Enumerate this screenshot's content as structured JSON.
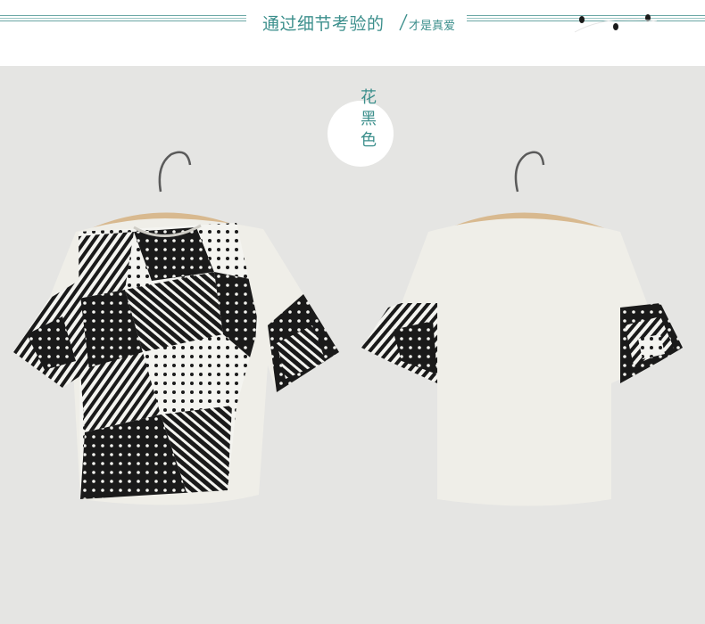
{
  "header": {
    "title": "通过细节考验的",
    "subtitle": "才是真爱"
  },
  "badge": {
    "color_name": "花黑色"
  },
  "images": [
    {
      "name": "shirt-front-photo",
      "description_icon": "patchwork-tshirt-front-on-hanger"
    },
    {
      "name": "shirt-back-photo",
      "description_icon": "tshirt-back-on-hanger"
    }
  ],
  "colors": {
    "accent": "#3c8f8c",
    "background": "#e5e5e3",
    "fabric": "#efeee8",
    "print": "#1a1a1a"
  }
}
